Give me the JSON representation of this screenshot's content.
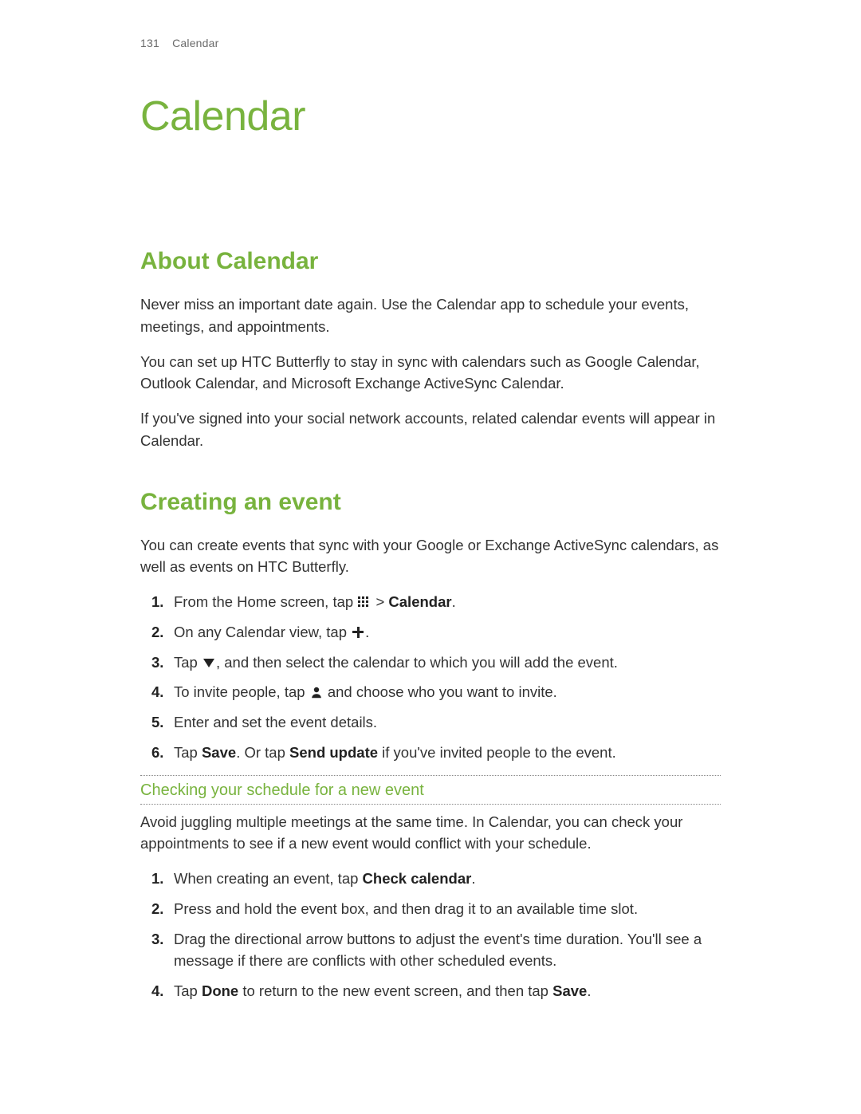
{
  "header": {
    "page_number": "131",
    "chapter": "Calendar"
  },
  "title": "Calendar",
  "sections": {
    "about": {
      "heading": "About Calendar",
      "p1": "Never miss an important date again. Use the Calendar app to schedule your events, meetings, and appointments.",
      "p2": "You can set up HTC Butterfly to stay in sync with calendars such as Google Calendar, Outlook Calendar, and Microsoft Exchange ActiveSync Calendar.",
      "p3": "If you've signed into your social network accounts, related calendar events will appear in Calendar."
    },
    "creating": {
      "heading": "Creating an event",
      "intro": "You can create events that sync with your Google or Exchange ActiveSync calendars, as well as events on HTC Butterfly.",
      "steps": {
        "s1": {
          "pre": "From the Home screen, tap ",
          "sep": " > ",
          "bold": "Calendar",
          "post": "."
        },
        "s2": {
          "pre": "On any Calendar view, tap ",
          "post": "."
        },
        "s3": {
          "pre": "Tap ",
          "post": ", and then select the calendar to which you will add the event."
        },
        "s4": {
          "pre": "To invite people, tap ",
          "post": " and choose who you want to invite."
        },
        "s5": "Enter and set the event details.",
        "s6": {
          "pre": "Tap ",
          "b1": "Save",
          "mid": ". Or tap ",
          "b2": "Send update",
          "post": " if you've invited people to the event."
        }
      }
    },
    "checking": {
      "heading": "Checking your schedule for a new event",
      "intro": "Avoid juggling multiple meetings at the same time. In Calendar, you can check your appointments to see if a new event would conflict with your schedule.",
      "steps": {
        "s1": {
          "pre": "When creating an event, tap ",
          "bold": "Check calendar",
          "post": "."
        },
        "s2": "Press and hold the event box, and then drag it to an available time slot.",
        "s3": "Drag the directional arrow buttons to adjust the event's time duration. You'll see a message if there are conflicts with other scheduled events.",
        "s4": {
          "pre": "Tap ",
          "b1": "Done",
          "mid": " to return to the new event screen, and then tap ",
          "b2": "Save",
          "post": "."
        }
      }
    }
  }
}
